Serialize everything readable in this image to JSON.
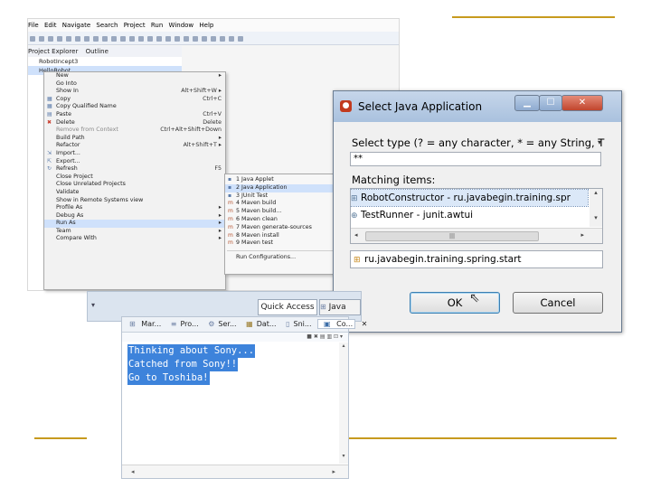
{
  "eclipse": {
    "menu": [
      "File",
      "Edit",
      "Navigate",
      "Search",
      "Project",
      "Run",
      "Window",
      "Help"
    ],
    "views_tab": "Project Explorer",
    "views_tab2": "Outline",
    "tree_items": [
      "RobotIncept3",
      "HelloRobot"
    ],
    "context_menu": [
      {
        "label": "New",
        "shortcut": "▸"
      },
      {
        "label": "Go Into",
        "shortcut": ""
      },
      {
        "label": "Show In",
        "shortcut": "Alt+Shift+W ▸"
      },
      {
        "label": "Copy",
        "shortcut": "Ctrl+C"
      },
      {
        "label": "Copy Qualified Name",
        "shortcut": ""
      },
      {
        "label": "Paste",
        "shortcut": "Ctrl+V"
      },
      {
        "label": "Delete",
        "shortcut": "Delete"
      },
      {
        "label": "Remove from Context",
        "shortcut": "Ctrl+Alt+Shift+Down"
      },
      {
        "label": "Build Path",
        "shortcut": "▸"
      },
      {
        "label": "Refactor",
        "shortcut": "Alt+Shift+T ▸"
      },
      {
        "label": "Import...",
        "shortcut": ""
      },
      {
        "label": "Export...",
        "shortcut": ""
      },
      {
        "label": "Refresh",
        "shortcut": "F5"
      },
      {
        "label": "Close Project",
        "shortcut": ""
      },
      {
        "label": "Close Unrelated Projects",
        "shortcut": ""
      },
      {
        "label": "Validate",
        "shortcut": ""
      },
      {
        "label": "Show in Remote Systems view",
        "shortcut": ""
      },
      {
        "label": "Profile As",
        "shortcut": "▸"
      },
      {
        "label": "Debug As",
        "shortcut": "▸"
      },
      {
        "label": "Run As",
        "shortcut": "▸"
      },
      {
        "label": "Team",
        "shortcut": "▸"
      },
      {
        "label": "Compare With",
        "shortcut": "▸"
      }
    ],
    "run_as_submenu": [
      {
        "label": "1 Java Applet",
        "shortcut": "A"
      },
      {
        "label": "2 Java Application",
        "shortcut": "A"
      },
      {
        "label": "3 JUnit Test",
        "shortcut": "A"
      },
      {
        "label": "4 Maven build",
        "shortcut": "Al"
      },
      {
        "label": "5 Maven build...",
        "shortcut": ""
      },
      {
        "label": "6 Maven clean",
        "shortcut": ""
      },
      {
        "label": "7 Maven generate-sources",
        "shortcut": ""
      },
      {
        "label": "8 Maven install",
        "shortcut": ""
      },
      {
        "label": "9 Maven test",
        "shortcut": ""
      },
      {
        "label": "Run Configurations...",
        "shortcut": ""
      }
    ]
  },
  "dialog": {
    "title": "Select Java Application",
    "select_type_label": "Select type (? = any character, * = any String, T",
    "filter_value": "**",
    "matching_label": "Matching items:",
    "items": [
      "RobotConstructor - ru.javabegin.training.spr",
      "TestRunner - junit.awtui"
    ],
    "package": "ru.javabegin.training.spring.start",
    "ok_label": "OK",
    "cancel_label": "Cancel",
    "hscroll_grip": "|||"
  },
  "ide": {
    "quick_access": "Quick Access",
    "perspective": "Java",
    "console_tabs": [
      "Mar...",
      "Pro...",
      "Ser...",
      "Dat...",
      "Sni...",
      "Co..."
    ],
    "console_lines": [
      "Thinking about Sony...",
      "Catched from Sony!!",
      "Go to Toshiba!"
    ]
  },
  "colors": {
    "slide_line": "#c79a1e",
    "selection": "#3d83db"
  }
}
